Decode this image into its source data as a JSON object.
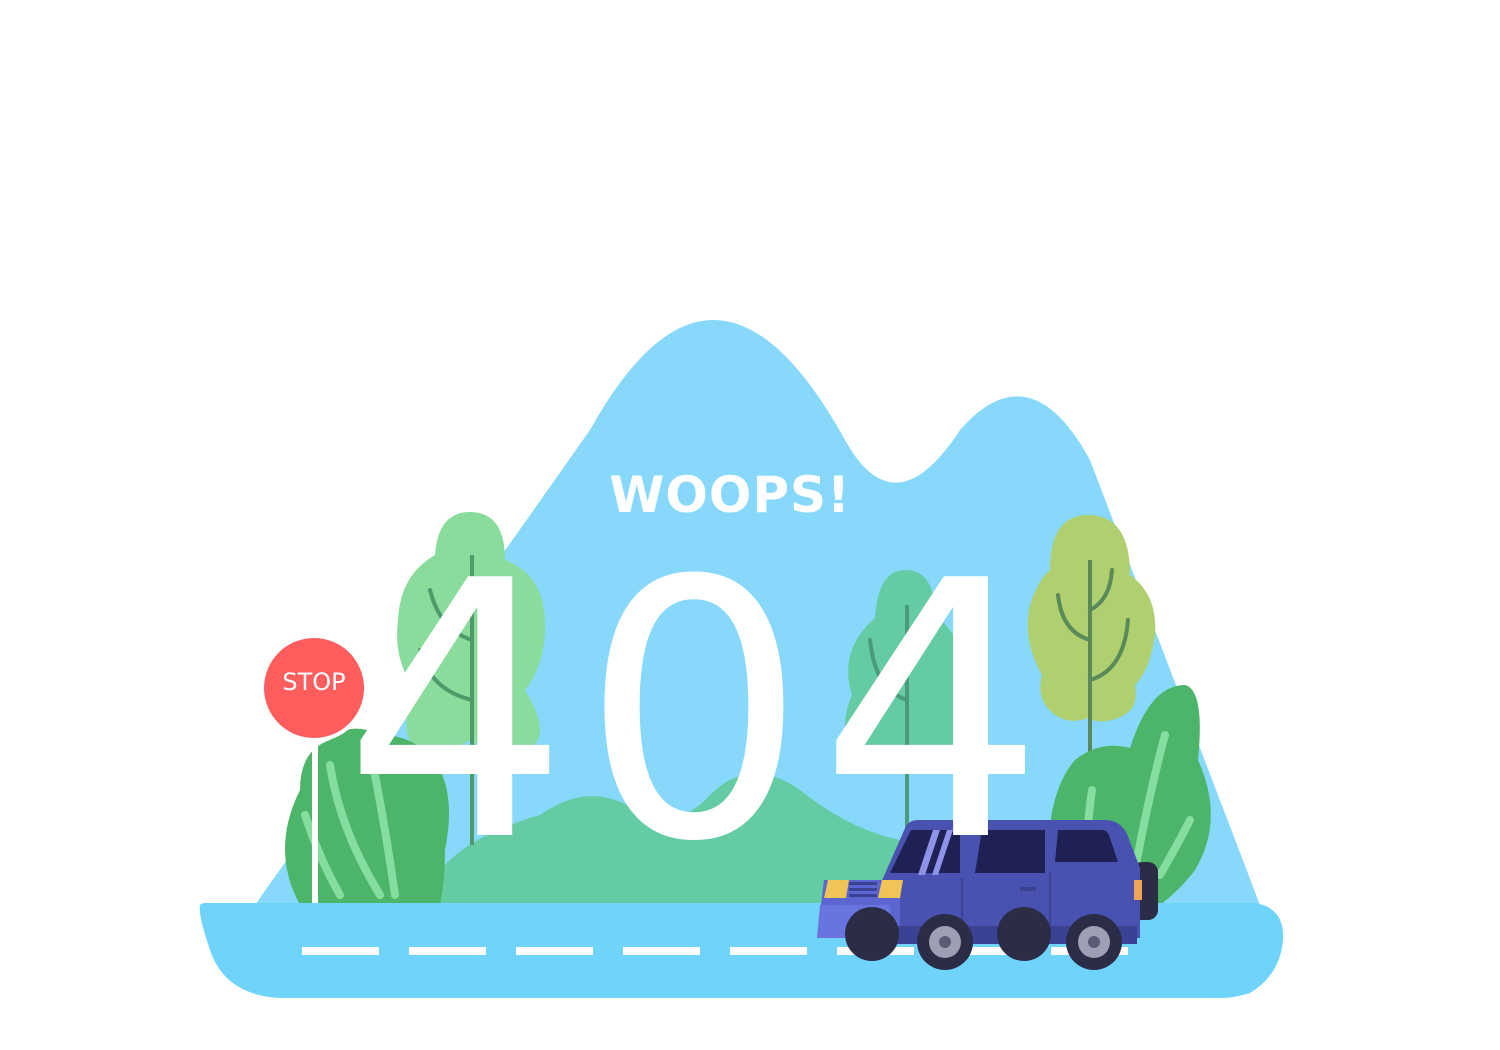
{
  "page": {
    "headline": "WOOPS!",
    "error_code": "404",
    "sign_text": "STOP"
  },
  "illustration": {
    "elements": [
      "mountains",
      "trees",
      "bushes",
      "road",
      "stop-sign",
      "car"
    ],
    "colors": {
      "mountain": "#87d8fb",
      "road": "#6fd3fc",
      "road_marking": "#ffffff",
      "stop_sign": "#fd5d5d",
      "tree_light_green": "#8adc9c",
      "tree_teal": "#64cba3",
      "tree_lime": "#b0d070",
      "bush_green": "#4db56a",
      "car_body": "#4a52b1",
      "car_window": "#1f2154",
      "headlight": "#f0c457"
    }
  }
}
